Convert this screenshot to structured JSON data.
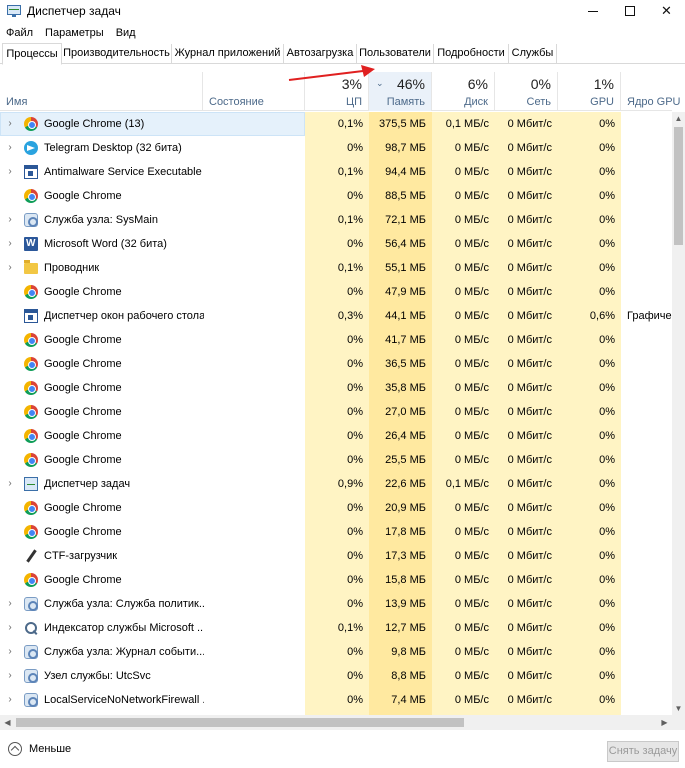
{
  "window": {
    "title": "Диспетчер задач"
  },
  "menu": [
    "Файл",
    "Параметры",
    "Вид"
  ],
  "tabs": [
    "Процессы",
    "Производительность",
    "Журнал приложений",
    "Автозагрузка",
    "Пользователи",
    "Подробности",
    "Службы"
  ],
  "active_tab": "Процессы",
  "columns": {
    "name": "Имя",
    "status": "Состояние",
    "cpu": {
      "percent": "3%",
      "label": "ЦП"
    },
    "memory": {
      "percent": "46%",
      "label": "Память",
      "sorted": true
    },
    "disk": {
      "percent": "6%",
      "label": "Диск"
    },
    "network": {
      "percent": "0%",
      "label": "Сеть"
    },
    "gpu": {
      "percent": "1%",
      "label": "GPU"
    },
    "gpu_engine": {
      "label": "Ядро GPU"
    }
  },
  "processes": [
    {
      "name": "Google Chrome (13)",
      "icon": "chrome-icon",
      "expandable": true,
      "cpu": "0,1%",
      "mem": "375,5 МБ",
      "disk": "0,1 МБ/с",
      "net": "0 Мбит/с",
      "gpu": "0%",
      "gpu_engine": "",
      "selected": true
    },
    {
      "name": "Telegram Desktop (32 бита)",
      "icon": "telegram-icon",
      "expandable": true,
      "cpu": "0%",
      "mem": "98,7 МБ",
      "disk": "0 МБ/с",
      "net": "0 Мбит/с",
      "gpu": "0%",
      "gpu_engine": ""
    },
    {
      "name": "Antimalware Service Executable",
      "icon": "window-icon",
      "expandable": true,
      "cpu": "0,1%",
      "mem": "94,4 МБ",
      "disk": "0 МБ/с",
      "net": "0 Мбит/с",
      "gpu": "0%",
      "gpu_engine": ""
    },
    {
      "name": "Google Chrome",
      "icon": "chrome-icon",
      "expandable": false,
      "cpu": "0%",
      "mem": "88,5 МБ",
      "disk": "0 МБ/с",
      "net": "0 Мбит/с",
      "gpu": "0%",
      "gpu_engine": ""
    },
    {
      "name": "Служба узла: SysMain",
      "icon": "gear-icon",
      "expandable": true,
      "cpu": "0,1%",
      "mem": "72,1 МБ",
      "disk": "0 МБ/с",
      "net": "0 Мбит/с",
      "gpu": "0%",
      "gpu_engine": ""
    },
    {
      "name": "Microsoft Word (32 бита)",
      "icon": "word-icon",
      "expandable": true,
      "cpu": "0%",
      "mem": "56,4 МБ",
      "disk": "0 МБ/с",
      "net": "0 Мбит/с",
      "gpu": "0%",
      "gpu_engine": ""
    },
    {
      "name": "Проводник",
      "icon": "folder-icon",
      "expandable": true,
      "cpu": "0,1%",
      "mem": "55,1 МБ",
      "disk": "0 МБ/с",
      "net": "0 Мбит/с",
      "gpu": "0%",
      "gpu_engine": ""
    },
    {
      "name": "Google Chrome",
      "icon": "chrome-icon",
      "expandable": false,
      "cpu": "0%",
      "mem": "47,9 МБ",
      "disk": "0 МБ/с",
      "net": "0 Мбит/с",
      "gpu": "0%",
      "gpu_engine": ""
    },
    {
      "name": "Диспетчер окон рабочего стола",
      "icon": "window-icon",
      "expandable": false,
      "cpu": "0,3%",
      "mem": "44,1 МБ",
      "disk": "0 МБ/с",
      "net": "0 Мбит/с",
      "gpu": "0,6%",
      "gpu_engine": "Графичес"
    },
    {
      "name": "Google Chrome",
      "icon": "chrome-icon",
      "expandable": false,
      "cpu": "0%",
      "mem": "41,7 МБ",
      "disk": "0 МБ/с",
      "net": "0 Мбит/с",
      "gpu": "0%",
      "gpu_engine": ""
    },
    {
      "name": "Google Chrome",
      "icon": "chrome-icon",
      "expandable": false,
      "cpu": "0%",
      "mem": "36,5 МБ",
      "disk": "0 МБ/с",
      "net": "0 Мбит/с",
      "gpu": "0%",
      "gpu_engine": ""
    },
    {
      "name": "Google Chrome",
      "icon": "chrome-icon",
      "expandable": false,
      "cpu": "0%",
      "mem": "35,8 МБ",
      "disk": "0 МБ/с",
      "net": "0 Мбит/с",
      "gpu": "0%",
      "gpu_engine": ""
    },
    {
      "name": "Google Chrome",
      "icon": "chrome-icon",
      "expandable": false,
      "cpu": "0%",
      "mem": "27,0 МБ",
      "disk": "0 МБ/с",
      "net": "0 Мбит/с",
      "gpu": "0%",
      "gpu_engine": ""
    },
    {
      "name": "Google Chrome",
      "icon": "chrome-icon",
      "expandable": false,
      "cpu": "0%",
      "mem": "26,4 МБ",
      "disk": "0 МБ/с",
      "net": "0 Мбит/с",
      "gpu": "0%",
      "gpu_engine": ""
    },
    {
      "name": "Google Chrome",
      "icon": "chrome-icon",
      "expandable": false,
      "cpu": "0%",
      "mem": "25,5 МБ",
      "disk": "0 МБ/с",
      "net": "0 Мбит/с",
      "gpu": "0%",
      "gpu_engine": ""
    },
    {
      "name": "Диспетчер задач",
      "icon": "taskmgr-icon",
      "expandable": true,
      "cpu": "0,9%",
      "mem": "22,6 МБ",
      "disk": "0,1 МБ/с",
      "net": "0 Мбит/с",
      "gpu": "0%",
      "gpu_engine": ""
    },
    {
      "name": "Google Chrome",
      "icon": "chrome-icon",
      "expandable": false,
      "cpu": "0%",
      "mem": "20,9 МБ",
      "disk": "0 МБ/с",
      "net": "0 Мбит/с",
      "gpu": "0%",
      "gpu_engine": ""
    },
    {
      "name": "Google Chrome",
      "icon": "chrome-icon",
      "expandable": false,
      "cpu": "0%",
      "mem": "17,8 МБ",
      "disk": "0 МБ/с",
      "net": "0 Мбит/с",
      "gpu": "0%",
      "gpu_engine": ""
    },
    {
      "name": "CTF-загрузчик",
      "icon": "pen-icon",
      "expandable": false,
      "cpu": "0%",
      "mem": "17,3 МБ",
      "disk": "0 МБ/с",
      "net": "0 Мбит/с",
      "gpu": "0%",
      "gpu_engine": ""
    },
    {
      "name": "Google Chrome",
      "icon": "chrome-icon",
      "expandable": false,
      "cpu": "0%",
      "mem": "15,8 МБ",
      "disk": "0 МБ/с",
      "net": "0 Мбит/с",
      "gpu": "0%",
      "gpu_engine": ""
    },
    {
      "name": "Служба узла: Служба политик...",
      "icon": "gear-icon",
      "expandable": true,
      "cpu": "0%",
      "mem": "13,9 МБ",
      "disk": "0 МБ/с",
      "net": "0 Мбит/с",
      "gpu": "0%",
      "gpu_engine": ""
    },
    {
      "name": "Индексатор службы Microsoft ...",
      "icon": "search-icon",
      "expandable": true,
      "cpu": "0,1%",
      "mem": "12,7 МБ",
      "disk": "0 МБ/с",
      "net": "0 Мбит/с",
      "gpu": "0%",
      "gpu_engine": ""
    },
    {
      "name": "Служба узла: Журнал событи...",
      "icon": "gear-icon",
      "expandable": true,
      "cpu": "0%",
      "mem": "9,8 МБ",
      "disk": "0 МБ/с",
      "net": "0 Мбит/с",
      "gpu": "0%",
      "gpu_engine": ""
    },
    {
      "name": "Узел службы: UtcSvc",
      "icon": "gear-icon",
      "expandable": true,
      "cpu": "0%",
      "mem": "8,8 МБ",
      "disk": "0 МБ/с",
      "net": "0 Мбит/с",
      "gpu": "0%",
      "gpu_engine": ""
    },
    {
      "name": "LocalServiceNoNetworkFirewall ...",
      "icon": "gear-icon",
      "expandable": true,
      "cpu": "0%",
      "mem": "7,4 МБ",
      "disk": "0 МБ/с",
      "net": "0 Мбит/с",
      "gpu": "0%",
      "gpu_engine": ""
    }
  ],
  "footer": {
    "fewer_details": "Меньше",
    "end_task": "Снять задачу"
  },
  "colors": {
    "heat_light": "#fff4c4",
    "heat_medium": "#ffe9a0",
    "sorted_header": "#eaf1f9",
    "selected_row": "#e5f1fb",
    "annotation_arrow": "#e02020"
  }
}
